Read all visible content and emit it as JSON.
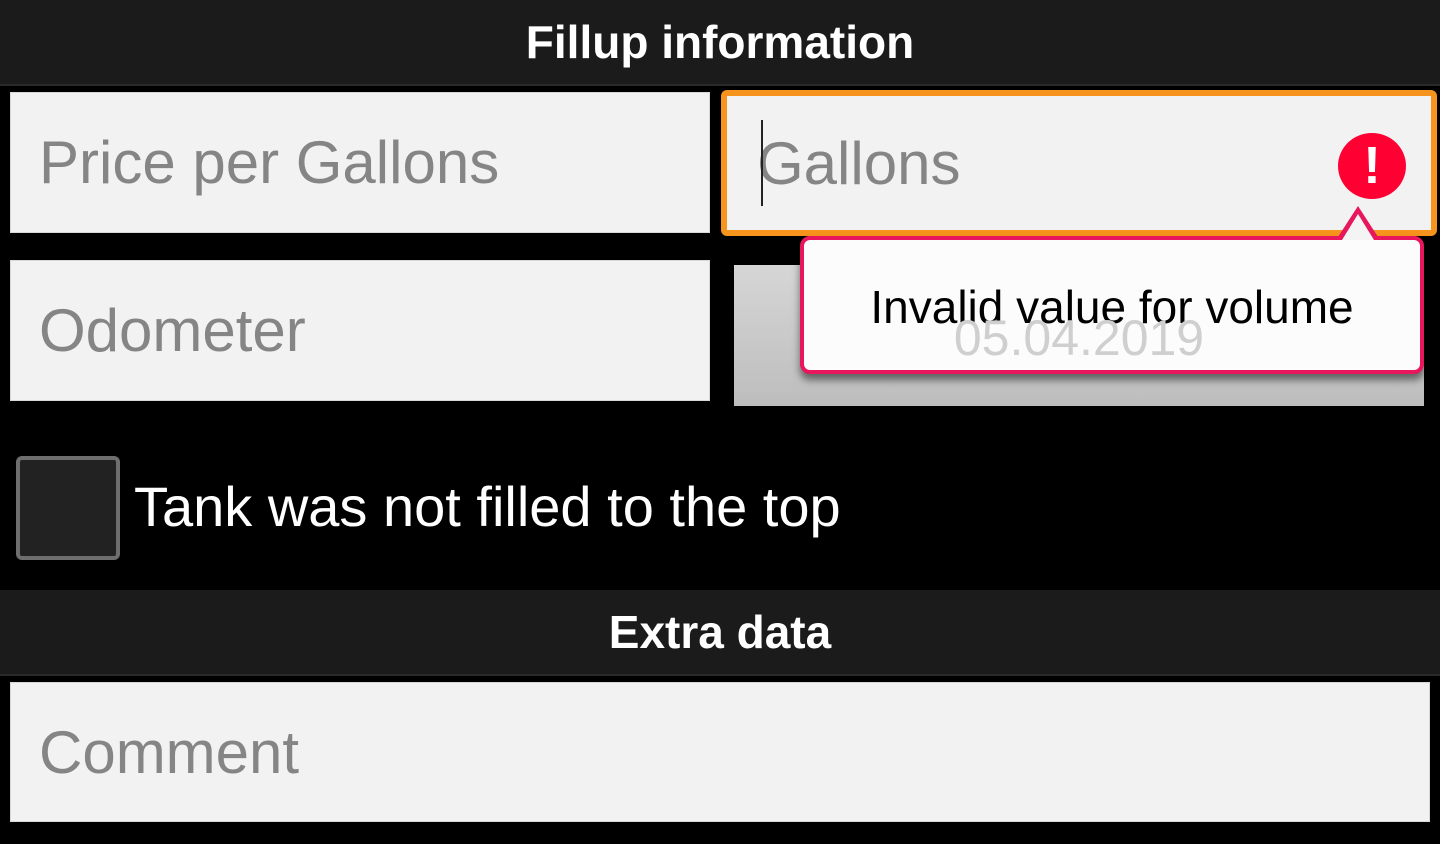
{
  "sections": {
    "fillup_title": "Fillup information",
    "extra_title": "Extra data"
  },
  "fields": {
    "price_placeholder": "Price per Gallons",
    "gallons_placeholder": "Gallons",
    "odometer_placeholder": "Odometer",
    "date_value": "05.04.2019",
    "comment_placeholder": "Comment"
  },
  "error": {
    "icon": "exclamation-icon",
    "message": "Invalid value for volume"
  },
  "checkbox": {
    "label": "Tank was not filled to the top",
    "checked": false
  },
  "colors": {
    "focus": "#f7941d",
    "error": "#ff0033",
    "popup_border": "#e8175d"
  }
}
